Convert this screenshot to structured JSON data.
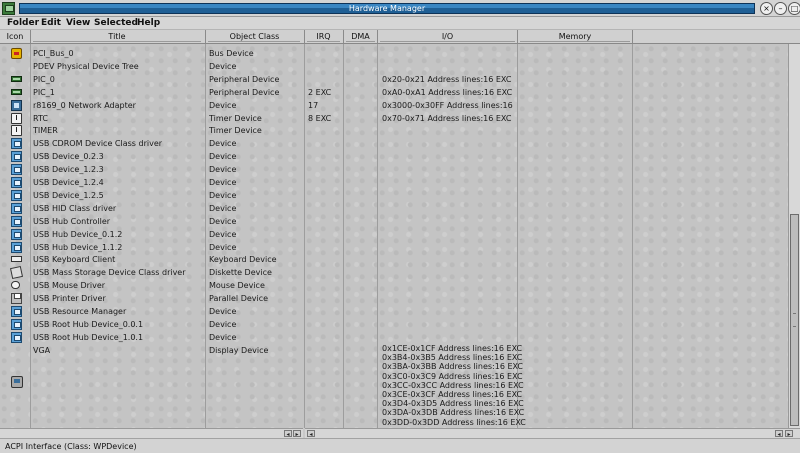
{
  "window": {
    "title": "Hardware Manager",
    "buttons": [
      "close-icon",
      "minimize-icon",
      "maximize-icon"
    ]
  },
  "menu": [
    "Folder",
    "Edit",
    "View",
    "Selected",
    "Help"
  ],
  "columns": [
    "Icon",
    "Title",
    "Object Class",
    "IRQ",
    "DMA",
    "I/O",
    "Memory"
  ],
  "devices": [
    {
      "icon": "bus-icon",
      "title": "PCI_Bus_0",
      "class": "Bus Device",
      "irq": "",
      "io": ""
    },
    {
      "icon": "none",
      "title": "PDEV Physical Device Tree",
      "class": "Device",
      "irq": "",
      "io": ""
    },
    {
      "icon": "chip-icon",
      "title": "PIC_0",
      "class": "Peripheral Device",
      "irq": "",
      "io": "0x20-0x21 Address lines:16  EXC"
    },
    {
      "icon": "chip-icon",
      "title": "PIC_1",
      "class": "Peripheral Device",
      "irq": "2  EXC",
      "io": "0xA0-0xA1 Address lines:16  EXC"
    },
    {
      "icon": "network-icon",
      "title": "r8169_0  Network Adapter",
      "class": "Device",
      "irq": "17",
      "io": "0x3000-0x30FF Address lines:16  EXC"
    },
    {
      "icon": "timer-icon",
      "title": "RTC",
      "class": "Timer Device",
      "irq": "8  EXC",
      "io": "0x70-0x71 Address lines:16  EXC"
    },
    {
      "icon": "timer-icon",
      "title": "TIMER",
      "class": "Timer Device",
      "irq": "",
      "io": ""
    },
    {
      "icon": "usb-icon",
      "title": "USB CDROM Device Class driver",
      "class": "Device",
      "irq": "",
      "io": ""
    },
    {
      "icon": "usb-icon",
      "title": "USB Device_0.2.3",
      "class": "Device",
      "irq": "",
      "io": ""
    },
    {
      "icon": "usb-icon",
      "title": "USB Device_1.2.3",
      "class": "Device",
      "irq": "",
      "io": ""
    },
    {
      "icon": "usb-icon",
      "title": "USB Device_1.2.4",
      "class": "Device",
      "irq": "",
      "io": ""
    },
    {
      "icon": "usb-icon",
      "title": "USB Device_1.2.5",
      "class": "Device",
      "irq": "",
      "io": ""
    },
    {
      "icon": "usb-icon",
      "title": "USB HID Class driver",
      "class": "Device",
      "irq": "",
      "io": ""
    },
    {
      "icon": "usb-icon",
      "title": "USB Hub Controller",
      "class": "Device",
      "irq": "",
      "io": ""
    },
    {
      "icon": "usb-icon",
      "title": "USB Hub Device_0.1.2",
      "class": "Device",
      "irq": "",
      "io": ""
    },
    {
      "icon": "usb-icon",
      "title": "USB Hub Device_1.1.2",
      "class": "Device",
      "irq": "",
      "io": ""
    },
    {
      "icon": "keyboard-icon",
      "title": "USB Keyboard Client",
      "class": "Keyboard Device",
      "irq": "",
      "io": ""
    },
    {
      "icon": "diskette-icon",
      "title": "USB Mass Storage Device Class driver",
      "class": "Diskette Device",
      "irq": "",
      "io": ""
    },
    {
      "icon": "mouse-icon",
      "title": "USB Mouse Driver",
      "class": "Mouse Device",
      "irq": "",
      "io": ""
    },
    {
      "icon": "printer-icon",
      "title": "USB Printer Driver",
      "class": "Parallel Device",
      "irq": "",
      "io": ""
    },
    {
      "icon": "usb-icon",
      "title": "USB Resource Manager",
      "class": "Device",
      "irq": "",
      "io": ""
    },
    {
      "icon": "usb-icon",
      "title": "USB Root Hub Device_0.0.1",
      "class": "Device",
      "irq": "",
      "io": ""
    },
    {
      "icon": "usb-icon",
      "title": "USB Root Hub Device_1.0.1",
      "class": "Device",
      "irq": "",
      "io": ""
    },
    {
      "icon": "display-icon",
      "title": "VGA",
      "class": "Display Device",
      "irq": "",
      "io": ""
    }
  ],
  "vga_io": [
    "0x1CE-0x1CF Address lines:16  EXC",
    "0x3B4-0x3B5 Address lines:16  EXC",
    "0x3BA-0x3BB Address lines:16  EXC",
    "0x3C0-0x3C9 Address lines:16  EXC",
    "0x3CC-0x3CC Address lines:16  EXC",
    "0x3CE-0x3CF Address lines:16  EXC",
    "0x3D4-0x3D5 Address lines:16  EXC",
    "0x3DA-0x3DB Address lines:16  EXC",
    "0x3DD-0x3DD Address lines:16  EXC"
  ],
  "status": "ACPI Interface (Class: WPDevice)"
}
